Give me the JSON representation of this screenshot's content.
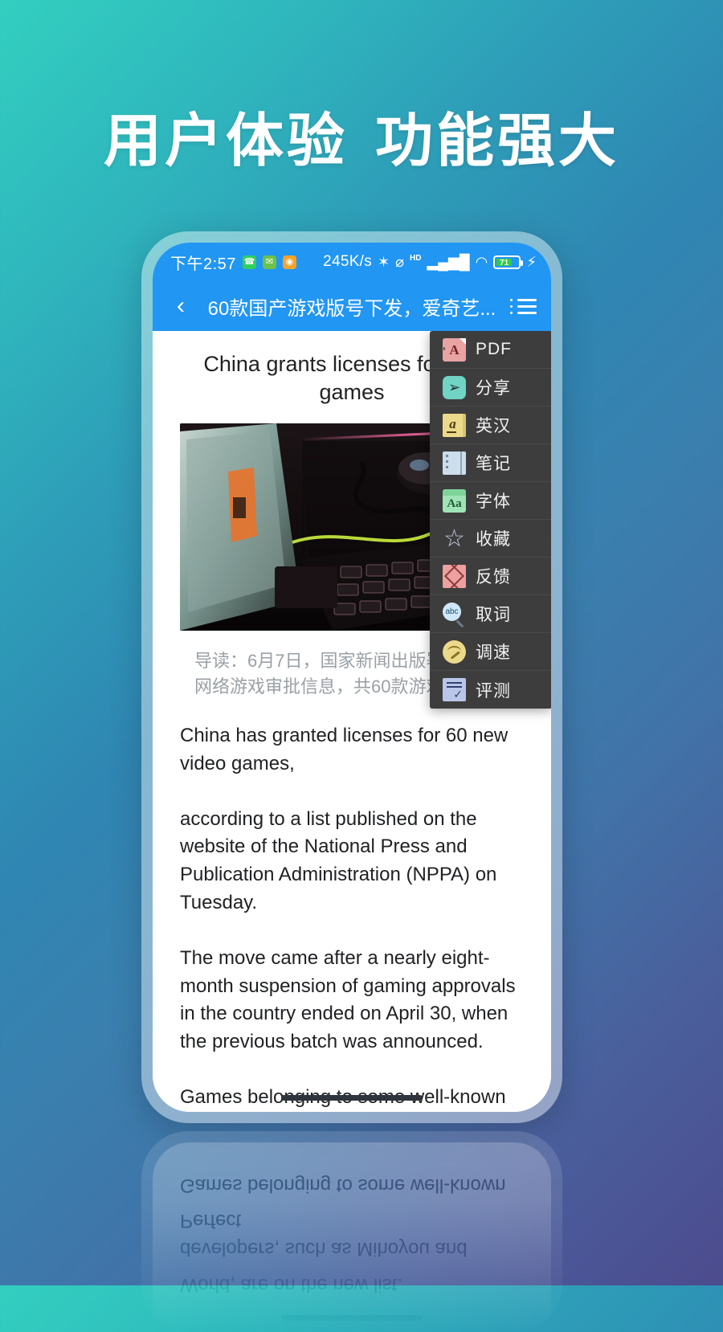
{
  "headline": {
    "part1": "用户体验",
    "part2": "功能强大"
  },
  "statusbar": {
    "time": "下午2:57",
    "app_icons": [
      {
        "name": "whatsapp-icon",
        "glyph": "●",
        "color": "#31cf5e"
      },
      {
        "name": "mail-icon",
        "glyph": "●",
        "color": "#6cc24a"
      },
      {
        "name": "reader-icon",
        "glyph": "●",
        "color": "#f5a32a"
      }
    ],
    "net_speed": "245K/s",
    "bluetooth": "✶",
    "mute": "⌀",
    "hd": "HD",
    "signal": "▂▄▆█",
    "wifi": "◠",
    "battery_level": "71",
    "battery_percent": 71,
    "charging": "⚡"
  },
  "titlebar": {
    "back": "‹",
    "title": "60款国产游戏版号下发，爱奇艺...",
    "menu_icon": "list-icon"
  },
  "article": {
    "title": "China grants licenses for video games",
    "photo_alt": "gaming desk with keyboard mouse and monitor",
    "summary": "导读：6月7日，国家新闻出版署发布国产网络游戏审批信息，共60款游戏过审",
    "paragraphs": [
      "China has granted licenses for 60 new video games,",
      "according to a list published on the website of the National Press and Publication Administration (NPPA) on Tuesday.",
      "The move came after a nearly eight-month suspension of gaming approvals in the country ended on April 30, when the previous batch was announced.",
      "Games belonging to some well-known developers, such as Mihoyou and Perfect World, are on the new list."
    ]
  },
  "menu": {
    "items": [
      {
        "label": "PDF",
        "icon": "pdf-icon",
        "icon_class": "ic-pdf",
        "glyph": "A",
        "color": "#e8a3a3"
      },
      {
        "label": "分享",
        "icon": "share-icon",
        "icon_class": "ic-share",
        "glyph": "➦",
        "color": "#6fd4c4"
      },
      {
        "label": "英汉",
        "icon": "dictionary-icon",
        "icon_class": "ic-dict",
        "glyph": "a",
        "color": "#ecd98a"
      },
      {
        "label": "笔记",
        "icon": "notebook-icon",
        "icon_class": "ic-note",
        "glyph": "",
        "color": "#cdddea"
      },
      {
        "label": "字体",
        "icon": "font-icon",
        "icon_class": "ic-font",
        "glyph": "Aa",
        "color": "#9fe3b6"
      },
      {
        "label": "收藏",
        "icon": "star-icon",
        "icon_class": "ic-star",
        "glyph": "☆",
        "color": "#c6cbe0"
      },
      {
        "label": "反馈",
        "icon": "feedback-icon",
        "icon_class": "ic-mail",
        "glyph": "",
        "color": "#eda0a0"
      },
      {
        "label": "取词",
        "icon": "word-lookup-icon",
        "icon_class": "ic-word",
        "glyph": "abc",
        "color": "#cfe8f7"
      },
      {
        "label": "调速",
        "icon": "speed-icon",
        "icon_class": "ic-speed",
        "glyph": "",
        "color": "#ecd98a"
      },
      {
        "label": "评测",
        "icon": "review-icon",
        "icon_class": "ic-test",
        "glyph": "",
        "color": "#b9c6ea"
      }
    ]
  },
  "reflection": {
    "line1": "World, are on the new list.",
    "line2": "developers, such as Mihoyou and Perfect",
    "line3": "Games belonging to some well-known"
  },
  "colors": {
    "accent_blue": "#2196f3",
    "bg_teal": "#33cfc0",
    "bg_purple": "#4c4b8e",
    "menu_bg": "#3d3d3d",
    "battery_green": "#2ecc44"
  }
}
